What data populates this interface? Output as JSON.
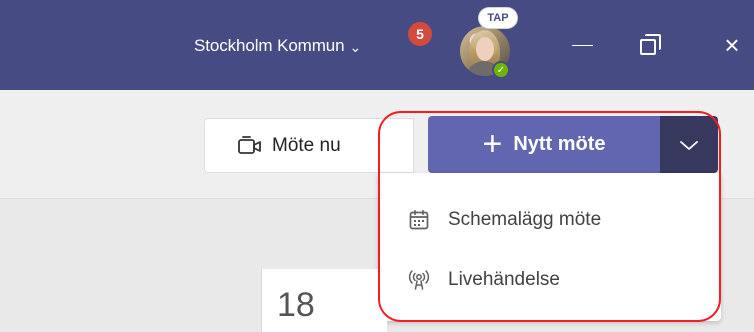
{
  "header": {
    "organization_name": "Stockholm Kommun",
    "organization_chevron": "⌄",
    "notification_count": "5",
    "avatar_badge": "TAP",
    "window_controls": {
      "minimize": "—",
      "restore": "restore-icon",
      "close": "×"
    }
  },
  "toolbar": {
    "meet_now_label": "Möte nu",
    "new_meeting_label": "Nytt möte",
    "new_meeting_plus": "+",
    "dropdown_arrow": "chevron-down-icon"
  },
  "dropdown": {
    "items": [
      {
        "label": "Schemalägg möte",
        "icon": "calendar-icon"
      },
      {
        "label": "Livehändelse",
        "icon": "live-event-icon"
      }
    ]
  },
  "calendar": {
    "day_number": "18"
  },
  "colors": {
    "titlebar": "#474b83",
    "new_meeting": "#6266b0",
    "split_arrow": "#36385d",
    "highlight": "#f51c23",
    "presence": "#6bb700",
    "notification": "#d34a3f"
  }
}
